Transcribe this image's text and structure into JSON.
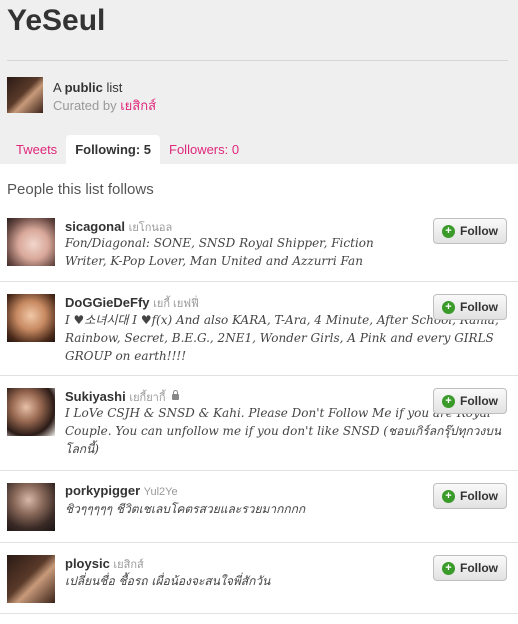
{
  "list": {
    "title": "YeSeul",
    "meta_prefix": "A ",
    "meta_type": "public",
    "meta_suffix": " list",
    "curated_by_label": "Curated by ",
    "curator": "เยสิกส์"
  },
  "tabs": [
    {
      "label": "Tweets",
      "active": false
    },
    {
      "label": "Following: 5",
      "active": true
    },
    {
      "label": "Followers: 0",
      "active": false
    }
  ],
  "section_title": "People this list follows",
  "follow_label": "Follow",
  "people": [
    {
      "screen_name": "sicagonal",
      "full_name": "เยโกนอล",
      "protected": false,
      "bio": "Fon/Diagonal: SONE, SNSD Royal Shipper, Fiction Writer, K-Pop Lover, Man United and Azzurri Fan"
    },
    {
      "screen_name": "DoGGieDeFfy",
      "full_name": "เยกี้ เยฟฟี่",
      "protected": false,
      "bio": "I ♥소녀시대 I ♥f(x) And also KARA, T-Ara, 4 Minute, After School, Rania, Rainbow, Secret, B.E.G., 2NE1, Wonder Girls, A Pink and every GIRLS GROUP on earth!!!!"
    },
    {
      "screen_name": "Sukiyashi",
      "full_name": "เยกี้ยากี้",
      "protected": true,
      "bio": "I LoVe CSJH & SNSD & Kahi. Please Don't Follow Me if you are Royal Couple. You can unfollow me if you don't like SNSD (ชอบเกิร์ลกรุ๊ปทุกวงบนโลกนี้)"
    },
    {
      "screen_name": "porkypigger",
      "full_name": "Yul2Ye",
      "protected": false,
      "bio": "ชิวๆๆๆๆๆ ชีวิตเชเลบโคตรสวยและรวยมากกกก"
    },
    {
      "screen_name": "ploysic",
      "full_name": "เยสิกส์",
      "protected": false,
      "bio": "เปลี่ยนชื่อ ชื้อรถ เผื่อน้องจะสนใจพี่สักวัน"
    }
  ],
  "colors": {
    "link_pink": "#e0287b",
    "header_bg": "#efefef",
    "follow_plus_green": "#3a9a2a"
  },
  "icons": {
    "follow": "plus-circle-icon",
    "protected": "lock-icon"
  }
}
